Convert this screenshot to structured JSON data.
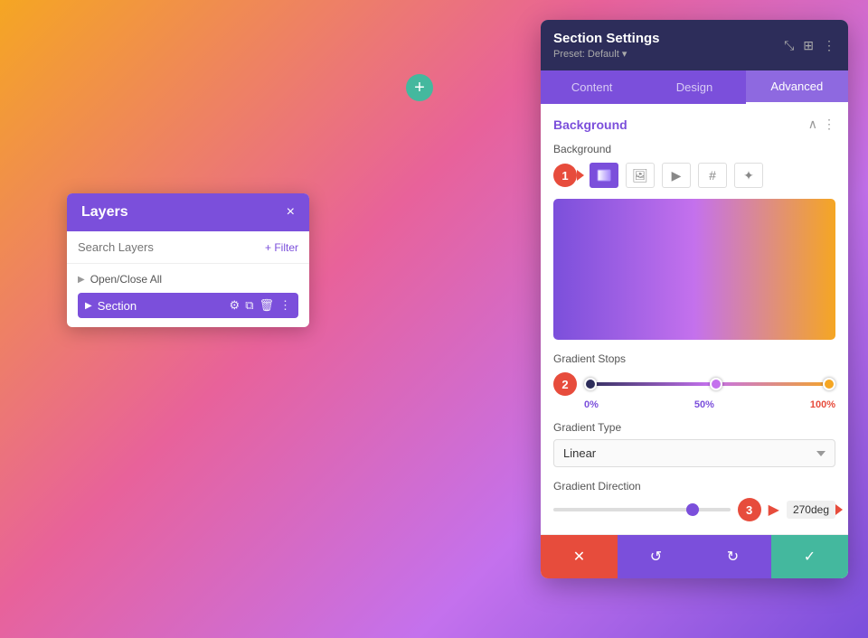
{
  "add_button": {
    "label": "+"
  },
  "layers_panel": {
    "title": "Layers",
    "close": "×",
    "search_placeholder": "Search Layers",
    "filter_label": "+ Filter",
    "open_close_all": "Open/Close All",
    "section_label": "Section"
  },
  "settings_panel": {
    "title": "Section Settings",
    "preset": "Preset: Default ▾",
    "tabs": [
      "Content",
      "Design",
      "Advanced"
    ],
    "active_tab": "Content",
    "bg_section_title": "Background",
    "bg_label": "Background",
    "gradient_stops_label": "Gradient Stops",
    "stop_percents": [
      "0%",
      "50%",
      "100%"
    ],
    "gradient_type_label": "Gradient Type",
    "gradient_type_value": "Linear",
    "gradient_direction_label": "Gradient Direction",
    "gradient_direction_value": "270deg",
    "steps": [
      "1",
      "2",
      "3"
    ],
    "footer": {
      "cancel": "✕",
      "undo": "↺",
      "redo": "↻",
      "save": "✓"
    }
  }
}
